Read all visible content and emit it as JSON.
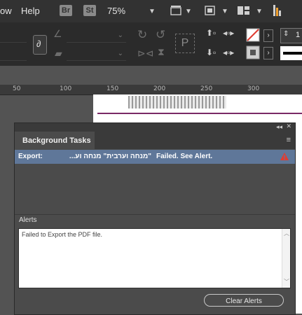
{
  "menubar": {
    "items": [
      "ow",
      "Help"
    ],
    "bridge_label": "Br",
    "stock_label": "St",
    "zoom": "75%"
  },
  "controlbar": {
    "link_icon": "link-icon",
    "text_sample": "P",
    "stepper_value": "1"
  },
  "ruler": {
    "ticks": [
      "50",
      "100",
      "150",
      "200",
      "250",
      "300"
    ]
  },
  "panel": {
    "title": "Background Tasks",
    "task": {
      "type": "Export:",
      "document": "\"מנחה וערבית\" מנחה וע...",
      "status": "Failed. See Alert."
    },
    "alerts_label": "Alerts",
    "alert_text": "Failed to Export the PDF file.",
    "clear_button": "Clear Alerts"
  },
  "colors": {
    "selection": "#5f7799",
    "warning": "#e03c31",
    "chrome": "#323232"
  }
}
